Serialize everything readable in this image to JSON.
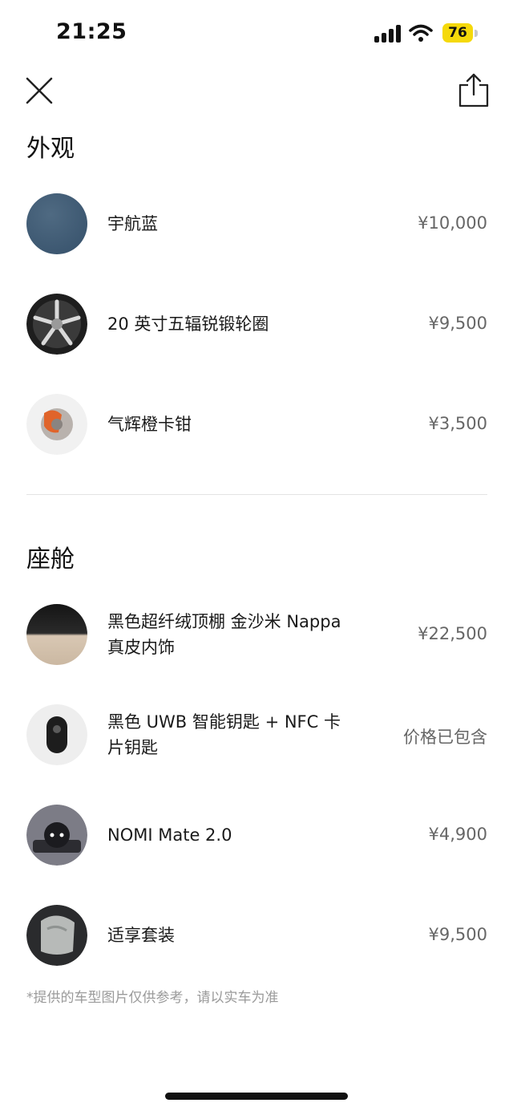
{
  "status": {
    "time": "21:25",
    "battery": "76"
  },
  "exterior": {
    "title": "外观",
    "items": [
      {
        "name": "宇航蓝",
        "price": "¥10,000"
      },
      {
        "name": "20 英寸五辐锐锻轮圈",
        "price": "¥9,500"
      },
      {
        "name": "气辉橙卡钳",
        "price": "¥3,500"
      }
    ]
  },
  "cabin": {
    "title": "座舱",
    "items": [
      {
        "name": "黑色超纤绒顶棚 金沙米 Nappa 真皮内饰",
        "price": "¥22,500"
      },
      {
        "name": "黑色 UWB 智能钥匙 + NFC 卡片钥匙",
        "price": "价格已包含"
      },
      {
        "name": "NOMI Mate 2.0",
        "price": "¥4,900"
      },
      {
        "name": "适享套装",
        "price": "¥9,500"
      }
    ]
  },
  "disclaimer": "*提供的车型图片仅供参考，请以实车为准",
  "colors": {
    "swatch_blue": "#3f5a72",
    "battery": "#f5d90a"
  }
}
